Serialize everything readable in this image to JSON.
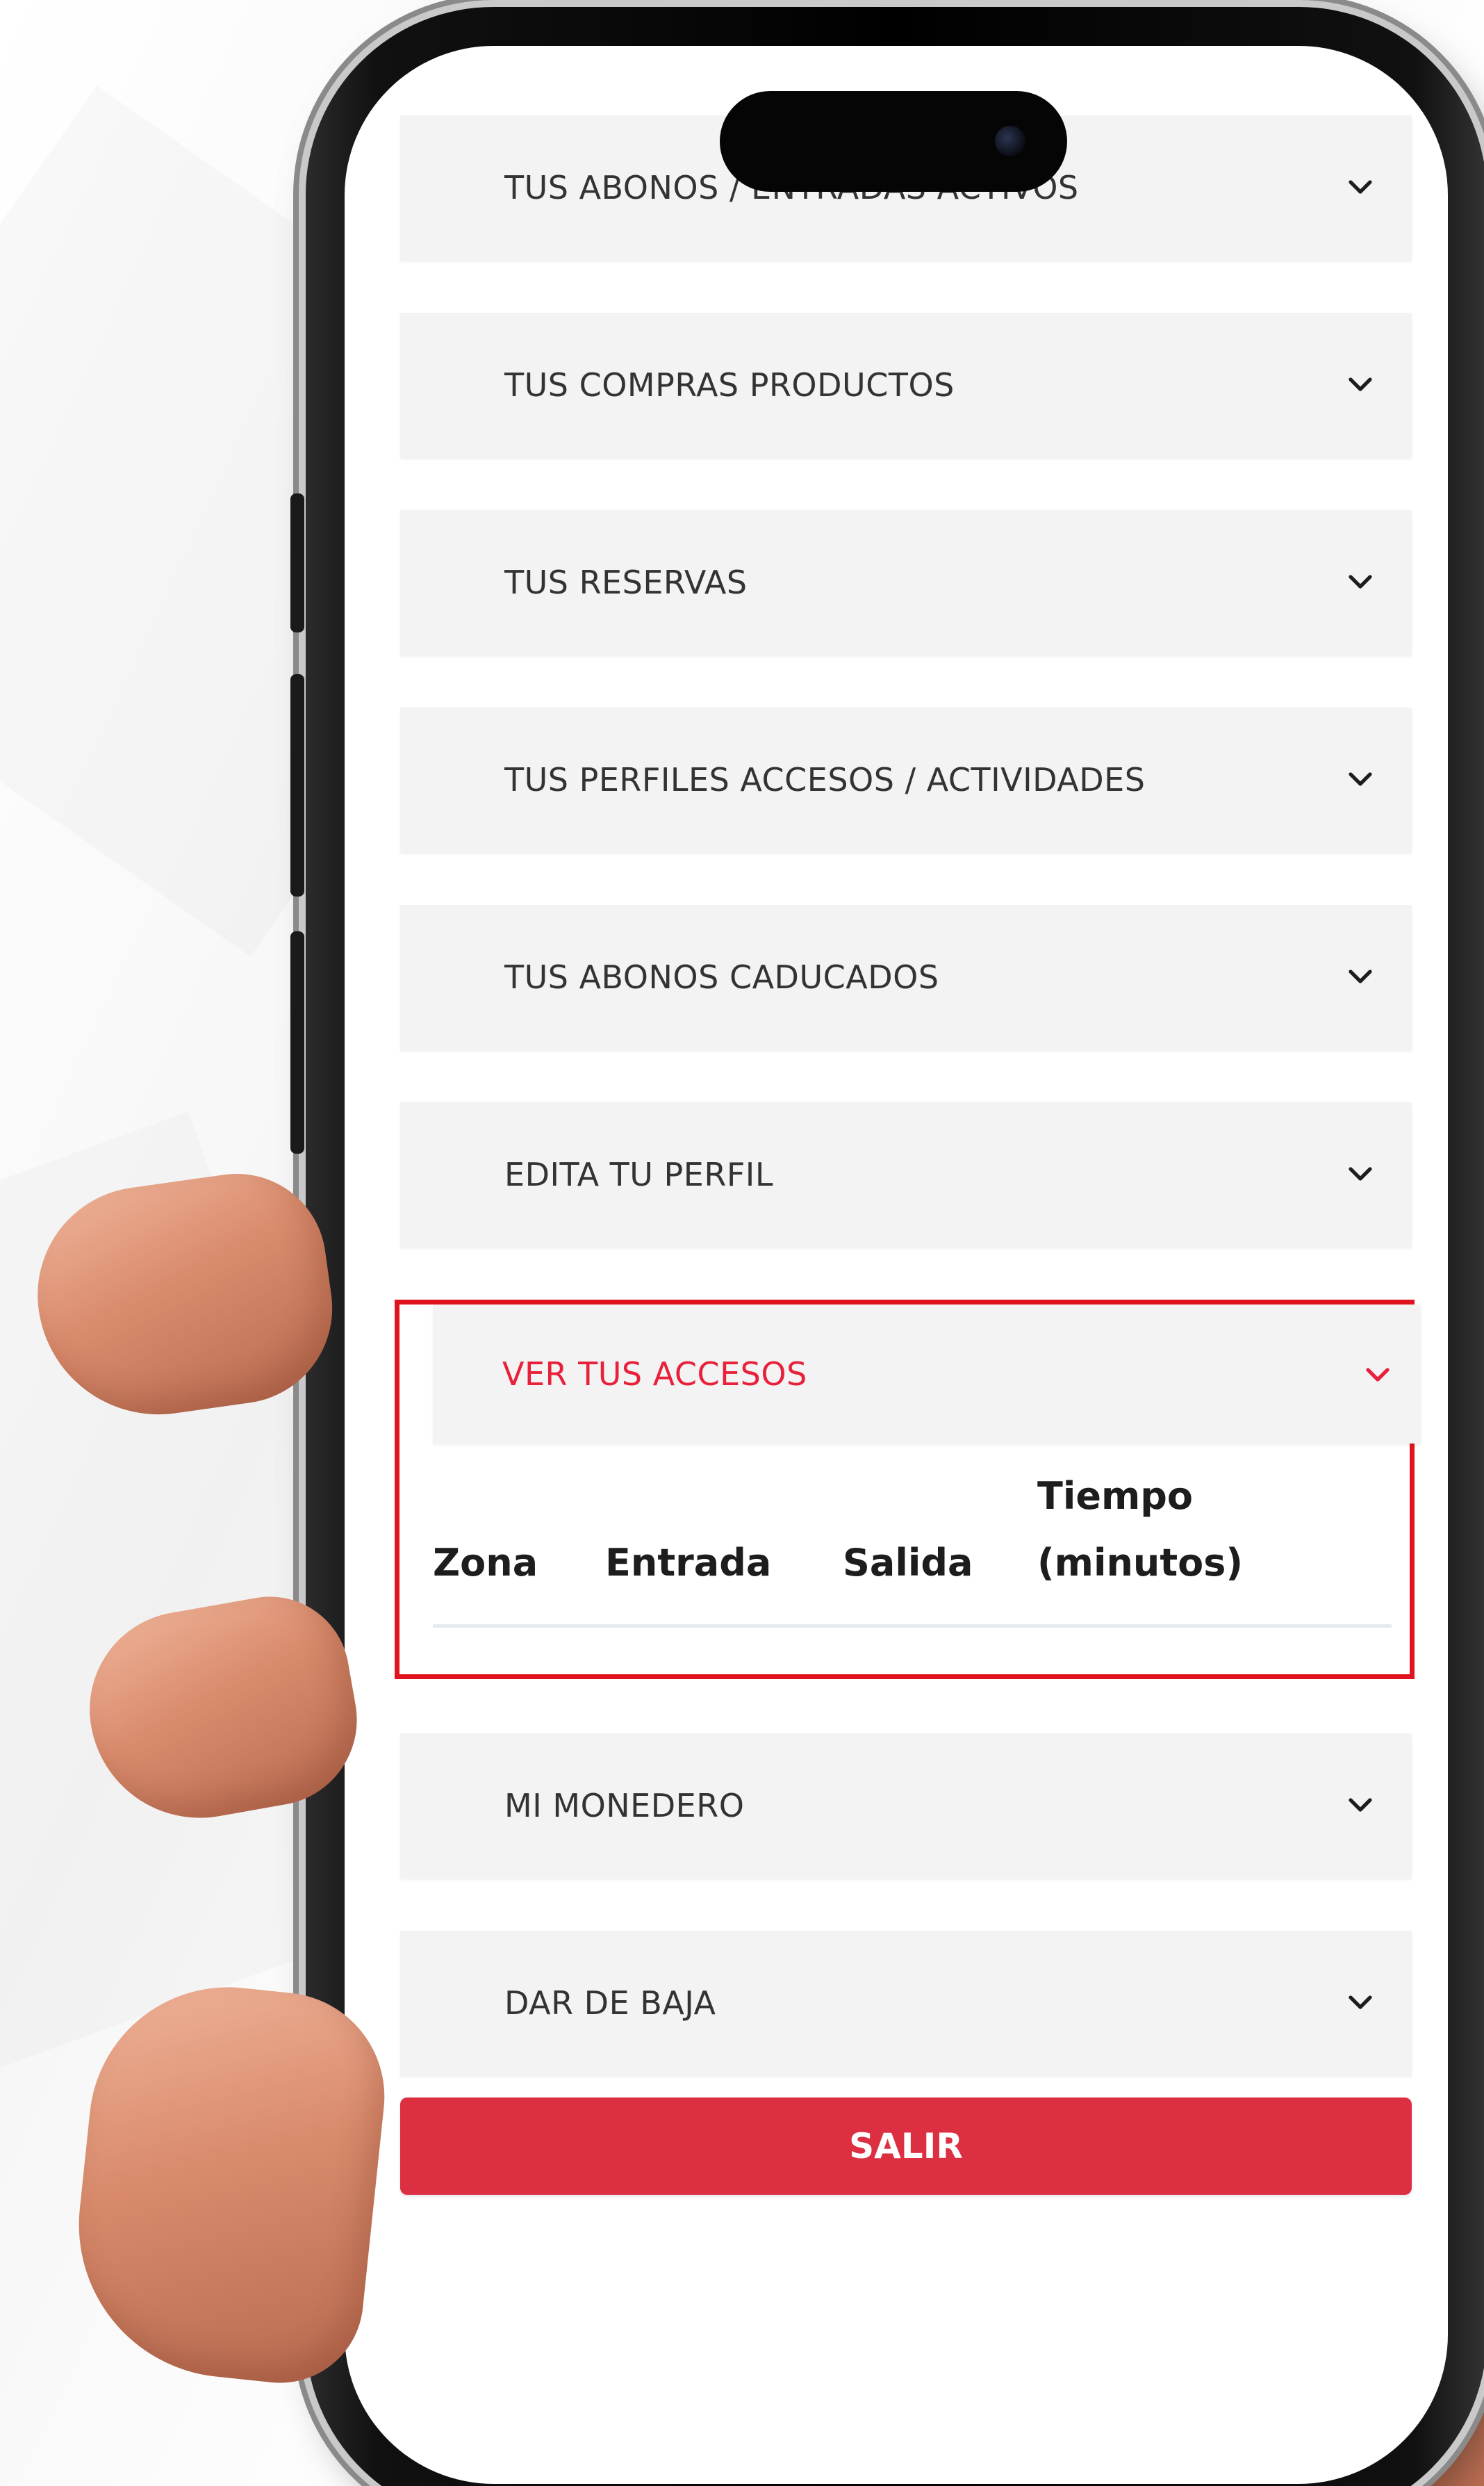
{
  "sections_before": [
    {
      "label": "TUS ABONOS / ENTRADAS ACTIVOS"
    },
    {
      "label": "TUS COMPRAS PRODUCTOS"
    },
    {
      "label": "TUS RESERVAS"
    },
    {
      "label": "TUS PERFILES ACCESOS / ACTIVIDADES"
    },
    {
      "label": "TUS ABONOS CADUCADOS"
    },
    {
      "label": "EDITA TU PERFIL"
    }
  ],
  "open_section": {
    "label": "VER TUS ACCESOS",
    "highlight_color": "#e0141e",
    "table": {
      "headers": [
        "Zona",
        "Entrada",
        "Salida",
        "Tiempo (minutos)"
      ],
      "rows": []
    }
  },
  "sections_after": [
    {
      "label": "MI MONEDERO"
    },
    {
      "label": "DAR DE BAJA"
    }
  ],
  "logout_button": {
    "label": "SALIR",
    "color": "#dc2f42"
  },
  "icons": {
    "collapsed_section": "chevron-down-icon",
    "open_section": "chevron-down-icon"
  }
}
